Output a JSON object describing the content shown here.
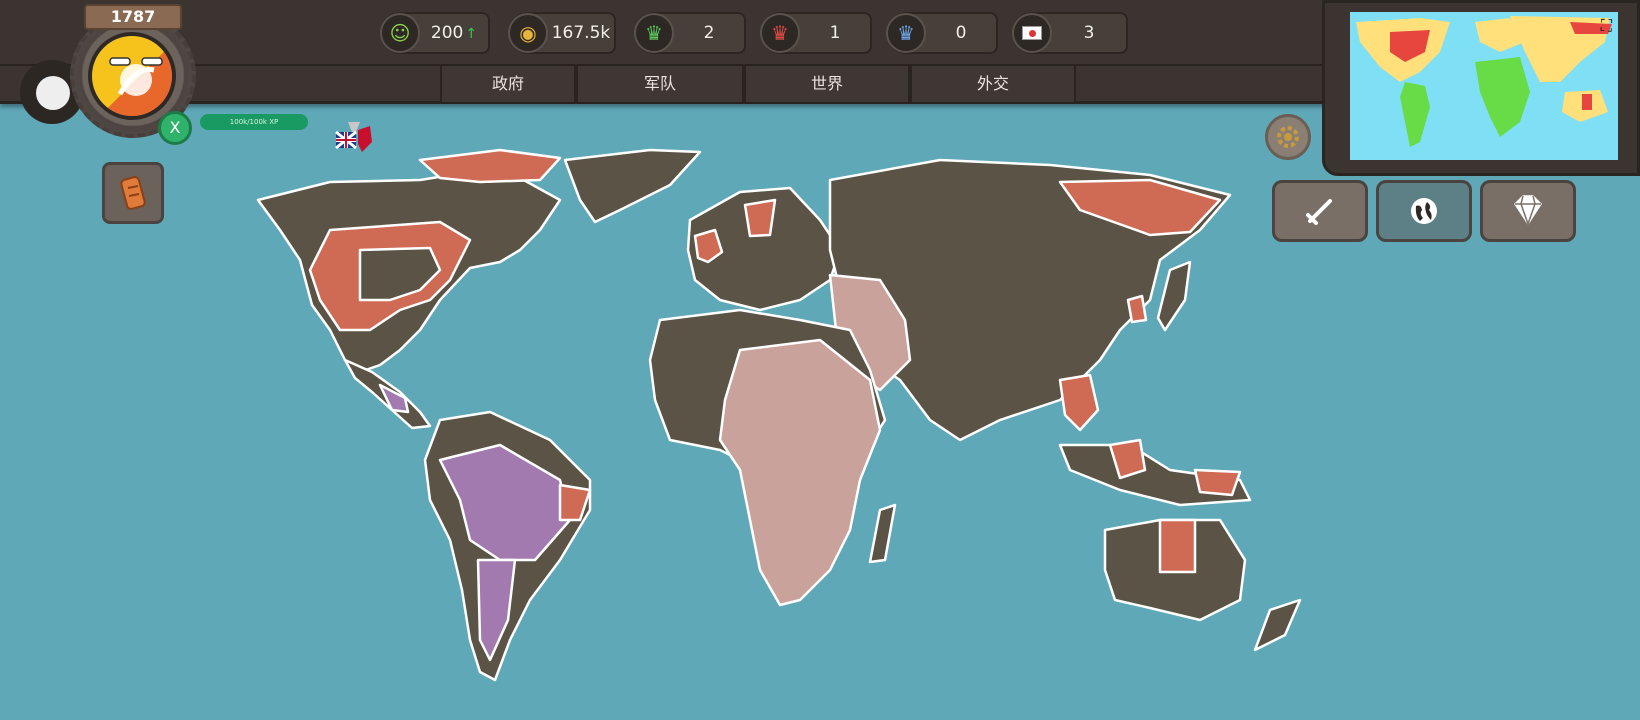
{
  "header": {
    "year": "1787",
    "xp_label": "100k/100k XP",
    "level_button": "X"
  },
  "resources": [
    {
      "name": "happiness",
      "icon": "smiley-icon",
      "value": "200",
      "trend": "up"
    },
    {
      "name": "gold",
      "icon": "coins-icon",
      "value": "167.5k",
      "trend": "up"
    },
    {
      "name": "green-crown",
      "icon": "green-crown-icon",
      "value": "2"
    },
    {
      "name": "red-crown",
      "icon": "red-crown-icon",
      "value": "1"
    },
    {
      "name": "blue-crown",
      "icon": "blue-crown-icon",
      "value": "0"
    },
    {
      "name": "flag",
      "icon": "japan-flag-icon",
      "value": "3"
    }
  ],
  "tabs": [
    {
      "label": "政府"
    },
    {
      "label": "军队"
    },
    {
      "label": "世界"
    },
    {
      "label": "外交"
    }
  ],
  "colors": {
    "ocean": "#5fa8b8",
    "own": "#5b5446",
    "enemy_red": "#cf6b55",
    "pink": "#c9a29c",
    "purple": "#a27ab0",
    "border": "#ffffff",
    "minimap_yellow": "#ffe07a",
    "minimap_green": "#67dc47",
    "minimap_red": "#e6463e"
  },
  "icons": {
    "settings": "gear-icon",
    "scroll": "scroll-icon",
    "sword": "sword-icon",
    "globe": "globe-icon",
    "diamond": "diamond-icon",
    "fullscreen": "fullscreen-icon",
    "map_pin": "uk-flag-pin-icon"
  }
}
